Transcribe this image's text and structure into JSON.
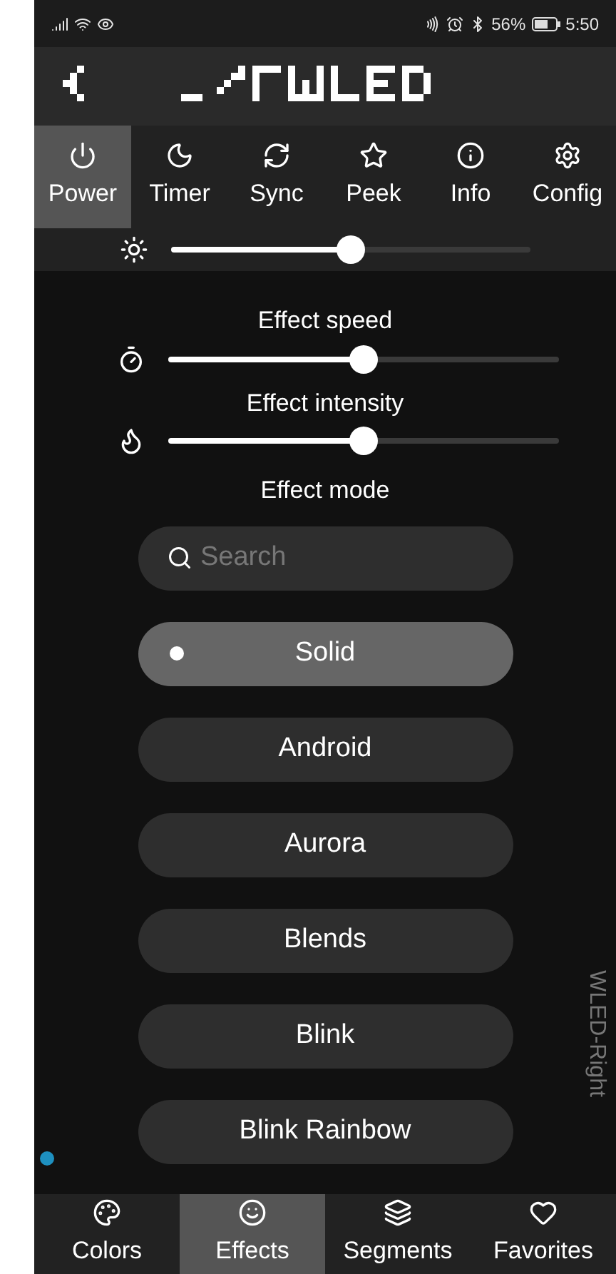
{
  "status_bar": {
    "battery": "56%",
    "time": "5:50"
  },
  "top_tabs": [
    {
      "label": "Power",
      "selected": true
    },
    {
      "label": "Timer",
      "selected": false
    },
    {
      "label": "Sync",
      "selected": false
    },
    {
      "label": "Peek",
      "selected": false
    },
    {
      "label": "Info",
      "selected": false
    },
    {
      "label": "Config",
      "selected": false
    }
  ],
  "brightness": {
    "level": 0.5
  },
  "effect_speed": {
    "label": "Effect speed",
    "level": 0.5
  },
  "effect_intensity": {
    "label": "Effect intensity",
    "level": 0.5
  },
  "effect_mode": {
    "label": "Effect mode",
    "search": {
      "placeholder": "Search"
    },
    "effects": [
      {
        "label": "Solid",
        "selected": true
      },
      {
        "label": "Android",
        "selected": false
      },
      {
        "label": "Aurora",
        "selected": false
      },
      {
        "label": "Blends",
        "selected": false
      },
      {
        "label": "Blink",
        "selected": false
      },
      {
        "label": "Blink Rainbow",
        "selected": false
      }
    ]
  },
  "device_name": "WLED-Right",
  "bottom_tabs": [
    {
      "label": "Colors",
      "selected": false
    },
    {
      "label": "Effects",
      "selected": true
    },
    {
      "label": "Segments",
      "selected": false
    },
    {
      "label": "Favorites",
      "selected": false
    }
  ]
}
